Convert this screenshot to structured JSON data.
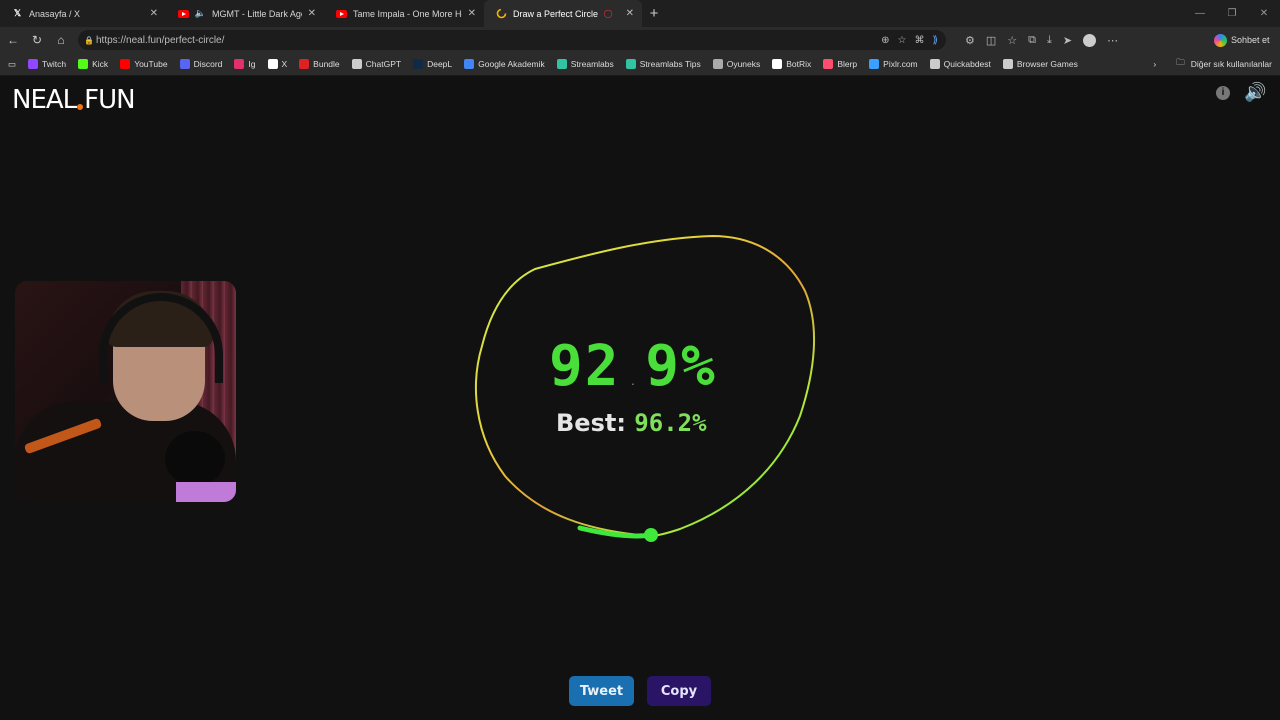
{
  "browser": {
    "tabs": [
      {
        "title": "Anasayfa / X",
        "icon": "x-logo-icon",
        "active": false
      },
      {
        "title": "MGMT - Little Dark Age (Offic",
        "icon": "youtube-icon",
        "active": false
      },
      {
        "title": "Tame Impala - One More Hour (O",
        "icon": "youtube-icon",
        "active": false
      },
      {
        "title": "Draw a Perfect Circle",
        "icon": "loading-icon",
        "active": true
      }
    ],
    "url": "https://neal.fun/perfect-circle/",
    "sohbet_label": "Sohbet et",
    "bookmarks": [
      {
        "label": "Twitch",
        "color": "#9146ff"
      },
      {
        "label": "Kick",
        "color": "#53fc18"
      },
      {
        "label": "YouTube",
        "color": "#ff0000"
      },
      {
        "label": "Discord",
        "color": "#5865f2"
      },
      {
        "label": "Ig",
        "color": "#e1306c"
      },
      {
        "label": "X",
        "color": "#ffffff"
      },
      {
        "label": "Bundle",
        "color": "#d22"
      },
      {
        "label": "ChatGPT",
        "color": "#cccccc"
      },
      {
        "label": "DeepL",
        "color": "#0f2b46"
      },
      {
        "label": "Google Akademik",
        "color": "#4285f4"
      },
      {
        "label": "Streamlabs",
        "color": "#31c3a2"
      },
      {
        "label": "Streamlabs Tips",
        "color": "#31c3a2"
      },
      {
        "label": "Oyuneks",
        "color": "#aaaaaa"
      },
      {
        "label": "BotRix",
        "color": "#ffffff"
      },
      {
        "label": "Blerp",
        "color": "#ff4d6d"
      },
      {
        "label": "Pixlr.com",
        "color": "#3aa0ff"
      },
      {
        "label": "Quickabdest",
        "color": "#cccccc"
      },
      {
        "label": "Browser Games",
        "color": "#cccccc"
      }
    ],
    "bookmarks_overflow_label": "Diğer sık kullanılanlar"
  },
  "page": {
    "logo_left": "NEAL",
    "logo_right": "FUN",
    "score_int": "92",
    "score_dec": "9%",
    "best_label": "Best:",
    "best_value": "96.2%",
    "tweet_label": "Tweet",
    "copy_label": "Copy"
  }
}
